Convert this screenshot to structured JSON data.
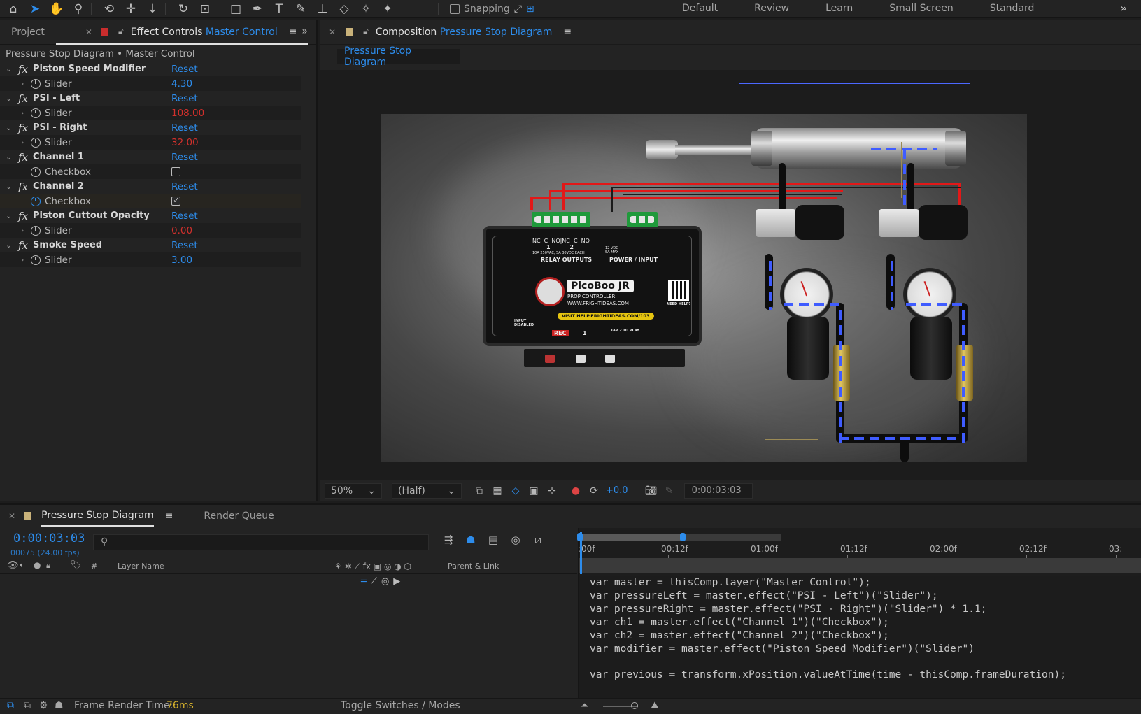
{
  "toolbar": {
    "tools": [
      "home-icon",
      "selection-icon",
      "hand-icon",
      "zoom-icon",
      "orbit-icon",
      "pan-icon",
      "dolly-icon",
      "rotate-icon",
      "anchor-icon",
      "rectangle-icon",
      "pen-icon",
      "type-icon",
      "brush-icon",
      "stamp-icon",
      "eraser-icon",
      "roto-icon",
      "puppet-icon"
    ],
    "snapping_label": "Snapping",
    "workspaces": [
      "Default",
      "Review",
      "Learn",
      "Small Screen",
      "Standard"
    ]
  },
  "left_panel": {
    "tab_project": "Project",
    "tab_effect_prefix": "Effect Controls",
    "tab_effect_layer": "Master Control",
    "header": "Pressure Stop Diagram • Master Control",
    "reset_label": "Reset",
    "effects": [
      {
        "name": "Piston Speed Modifier",
        "prop": "Slider",
        "value": "4.30",
        "value_color": "blue",
        "kind": "slider"
      },
      {
        "name": "PSI - Left",
        "prop": "Slider",
        "value": "108.00",
        "value_color": "red",
        "kind": "slider"
      },
      {
        "name": "PSI - Right",
        "prop": "Slider",
        "value": "32.00",
        "value_color": "red",
        "kind": "slider"
      },
      {
        "name": "Channel 1",
        "prop": "Checkbox",
        "checked": false,
        "kind": "checkbox"
      },
      {
        "name": "Channel 2",
        "prop": "Checkbox",
        "checked": true,
        "kind": "checkbox"
      },
      {
        "name": "Piston Cuttout Opacity",
        "prop": "Slider",
        "value": "0.00",
        "value_color": "red",
        "kind": "slider"
      },
      {
        "name": "Smoke Speed",
        "prop": "Slider",
        "value": "3.00",
        "value_color": "blue",
        "kind": "slider"
      }
    ]
  },
  "comp_panel": {
    "tab_prefix": "Composition",
    "tab_comp_name": "Pressure Stop Diagram",
    "flow_label": "Pressure Stop Diagram",
    "controller": {
      "relay_label": "RELAY OUTPUTS",
      "power_label": "POWER / INPUT",
      "brand": "PicoBoo JR",
      "sub": "PROP CONTROLLER",
      "url": "WWW.FRIGHTIDEAS.COM",
      "help": "VISIT HELP.FRIGHTIDEAS.COM/103",
      "terminal_top_left": "NC  C  NO|NC  C  NO",
      "terminal_numbers": "1          2",
      "rating": "10A 250VAC, 5A 30VDC EACH",
      "power_spec": "12 VDC 5A MAX",
      "input_disabled": "INPUT DISABLED",
      "rec": "REC",
      "btn1": "1",
      "tap_play": "TAP 2 TO PLAY",
      "need_help": "NEED HELP?"
    },
    "viewer_bar": {
      "zoom": "50%",
      "resolution": "(Half)",
      "exposure": "+0.0",
      "timecode": "0:00:03:03"
    }
  },
  "timeline": {
    "tab_comp": "Pressure Stop Diagram",
    "tab_render": "Render Queue",
    "timecode": "0:00:03:03",
    "frames": "00075 (24.00 fps)",
    "search_placeholder": "",
    "col_hash": "#",
    "col_layer_name": "Layer Name",
    "col_parent": "Parent & Link",
    "ruler": [
      ":00f",
      "00:12f",
      "01:00f",
      "01:12f",
      "02:00f",
      "02:12f",
      "03:"
    ],
    "expression": [
      "var master = thisComp.layer(\"Master Control\");",
      "var pressureLeft = master.effect(\"PSI - Left\")(\"Slider\");",
      "var pressureRight = master.effect(\"PSI - Right\")(\"Slider\") * 1.1;",
      "var ch1 = master.effect(\"Channel 1\")(\"Checkbox\");",
      "var ch2 = master.effect(\"Channel 2\")(\"Checkbox\");",
      "var modifier = master.effect(\"Piston Speed Modifier\")(\"Slider\")",
      "",
      "var previous = transform.xPosition.valueAtTime(time - thisComp.frameDuration);"
    ]
  },
  "status_bar": {
    "render_time_label": "Frame Render Time:",
    "render_time_value": "76ms",
    "toggle_label": "Toggle Switches / Modes"
  }
}
